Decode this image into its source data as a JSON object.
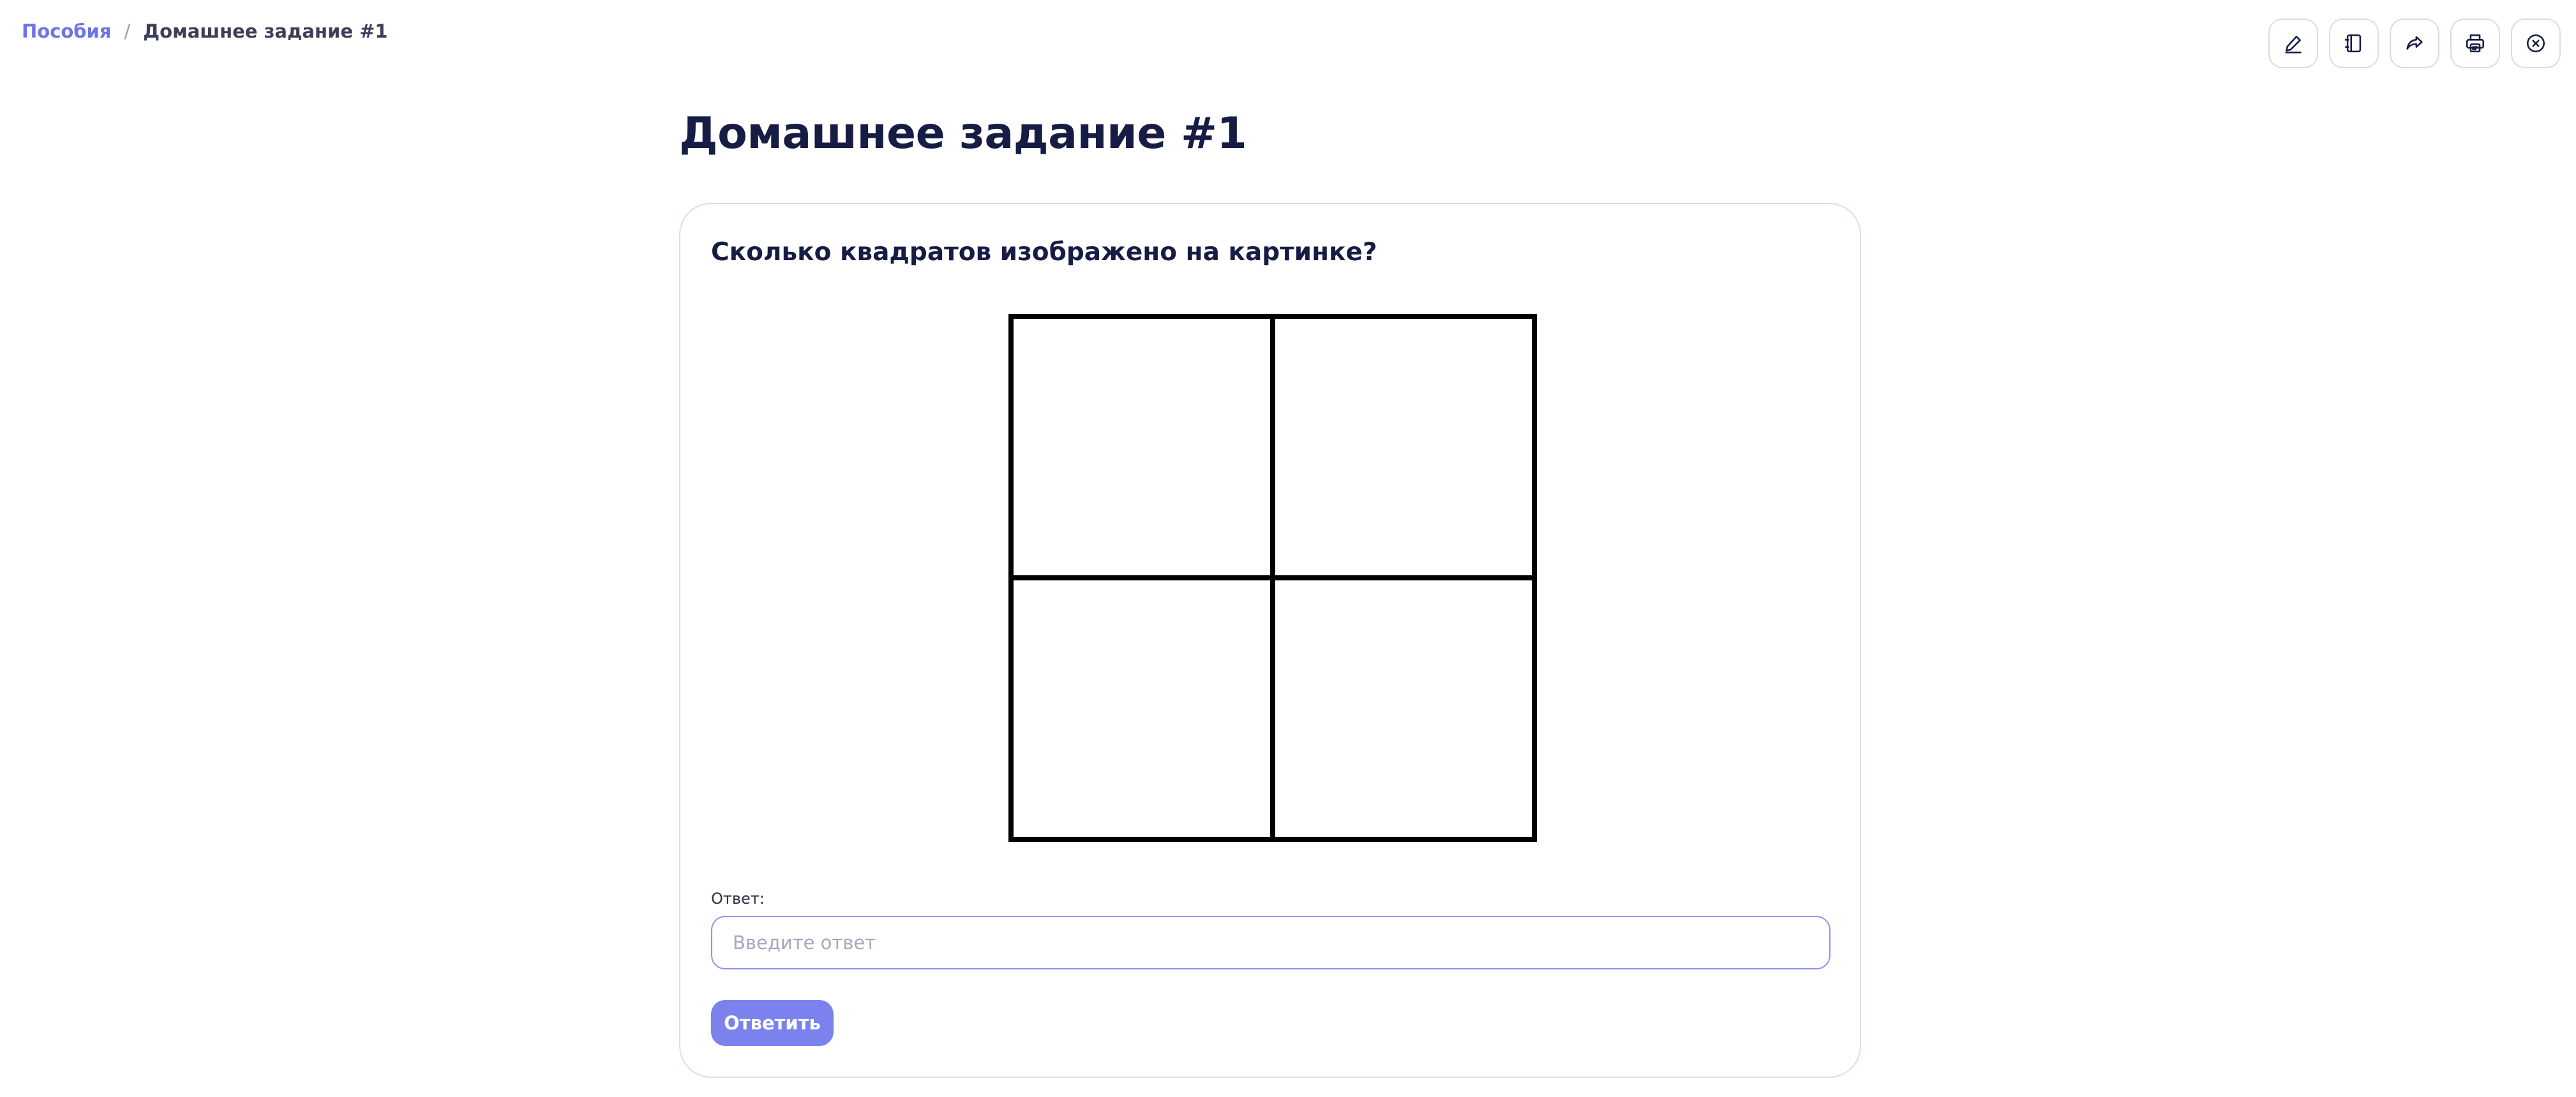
{
  "breadcrumb": {
    "parent": "Пособия",
    "separator": "/",
    "current": "Домашнее задание #1"
  },
  "toolbar": {
    "buttons": [
      {
        "icon": "pencil-icon"
      },
      {
        "icon": "notebook-icon"
      },
      {
        "icon": "share-arrow-icon"
      },
      {
        "icon": "printer-icon"
      },
      {
        "icon": "close-circle-icon"
      }
    ]
  },
  "page": {
    "title": "Домашнее задание #1"
  },
  "task": {
    "question": "Сколько квадратов изображено на картинке?",
    "figure": {
      "grid_rows": 2,
      "grid_cols": 2
    },
    "answer_label": "Ответ:",
    "answer_value": "",
    "answer_placeholder": "Введите ответ",
    "submit_label": "Ответить"
  },
  "colors": {
    "link": "#6b74e8",
    "title": "#161c44",
    "primary_button": "#7b82ee",
    "input_border": "#8c93ee",
    "card_border": "#d9dcf5"
  }
}
